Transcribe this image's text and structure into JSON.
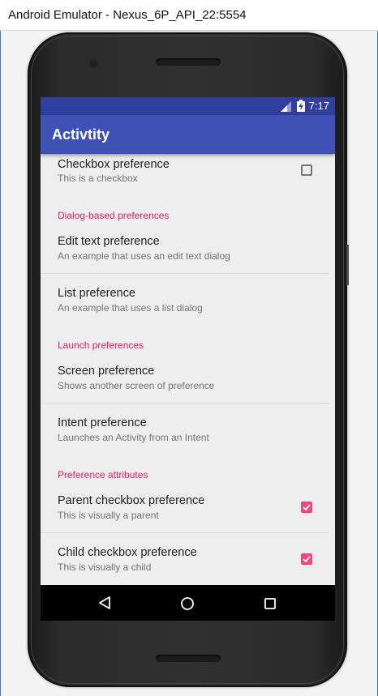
{
  "window": {
    "title": "Android Emulator - Nexus_6P_API_22:5554"
  },
  "status_bar": {
    "time": "7:17",
    "signal_icon": "signal-icon",
    "battery_icon": "battery-charging-icon"
  },
  "app_bar": {
    "title": "Activtity"
  },
  "prefs": {
    "checkbox": {
      "title": "Checkbox preference",
      "summary": "This is a checkbox",
      "checked": false
    },
    "dialog_category": "Dialog-based preferences",
    "edit_text": {
      "title": "Edit text preference",
      "summary": "An example that uses an edit text dialog"
    },
    "list": {
      "title": "List preference",
      "summary": "An example that uses a list dialog"
    },
    "launch_category": "Launch preferences",
    "screen": {
      "title": "Screen preference",
      "summary": "Shows another screen of preference"
    },
    "intent": {
      "title": "Intent preference",
      "summary": "Launches an Activity from an Intent"
    },
    "attributes_category": "Preference attributes",
    "parent_checkbox": {
      "title": "Parent checkbox preference",
      "summary": "This is visually a parent",
      "checked": true
    },
    "child_checkbox": {
      "title": "Child checkbox preference",
      "summary": "This is visually a child",
      "checked": true
    }
  },
  "nav_bar": {
    "back_icon": "back-triangle-icon",
    "home_icon": "home-circle-icon",
    "recents_icon": "recents-square-icon"
  },
  "colors": {
    "primary": "#3f51b5",
    "primary_dark": "#303f9f",
    "accent": "#ff4081",
    "category_text": "#e91e63"
  }
}
